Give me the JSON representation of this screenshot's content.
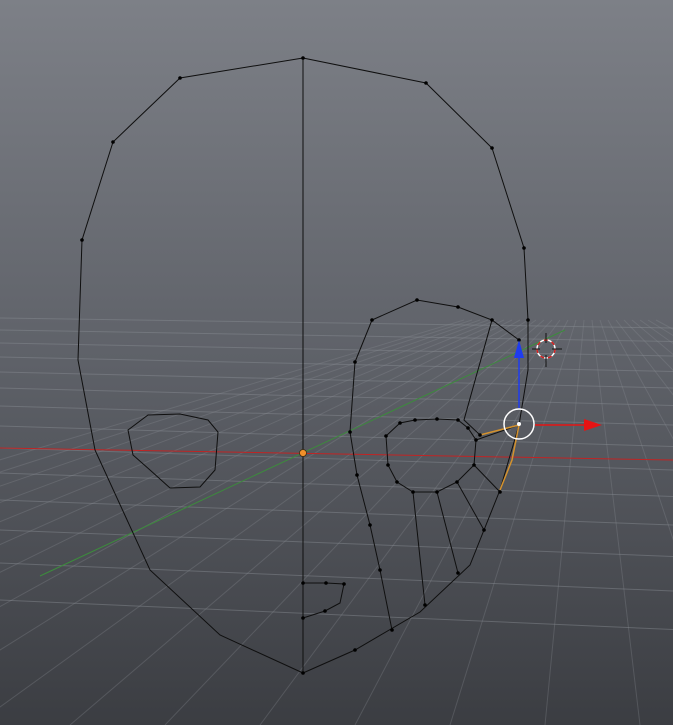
{
  "viewport": {
    "mode": "edit",
    "background_top": "#7d8087",
    "background_bottom": "#3b3d42"
  },
  "colors": {
    "grid_line": "#8a8d94",
    "x_axis": "#c02424",
    "y_axis": "#3c8c3c",
    "mesh_edge": "#0f0f0f",
    "vertex": "#000000",
    "object_origin": "#f0902a",
    "selected_edge": "#d4922e",
    "gizmo_x": "#e61414",
    "gizmo_z": "#1e3cf0",
    "gizmo_circle": "#ffffff",
    "cursor_ring_red": "#d21e1e",
    "cursor_ring_white": "#ffffff"
  },
  "icons": {
    "translate_gizmo": "translate-manipulator-icon",
    "cursor_3d": "3d-cursor-icon",
    "origin": "object-origin-icon"
  }
}
